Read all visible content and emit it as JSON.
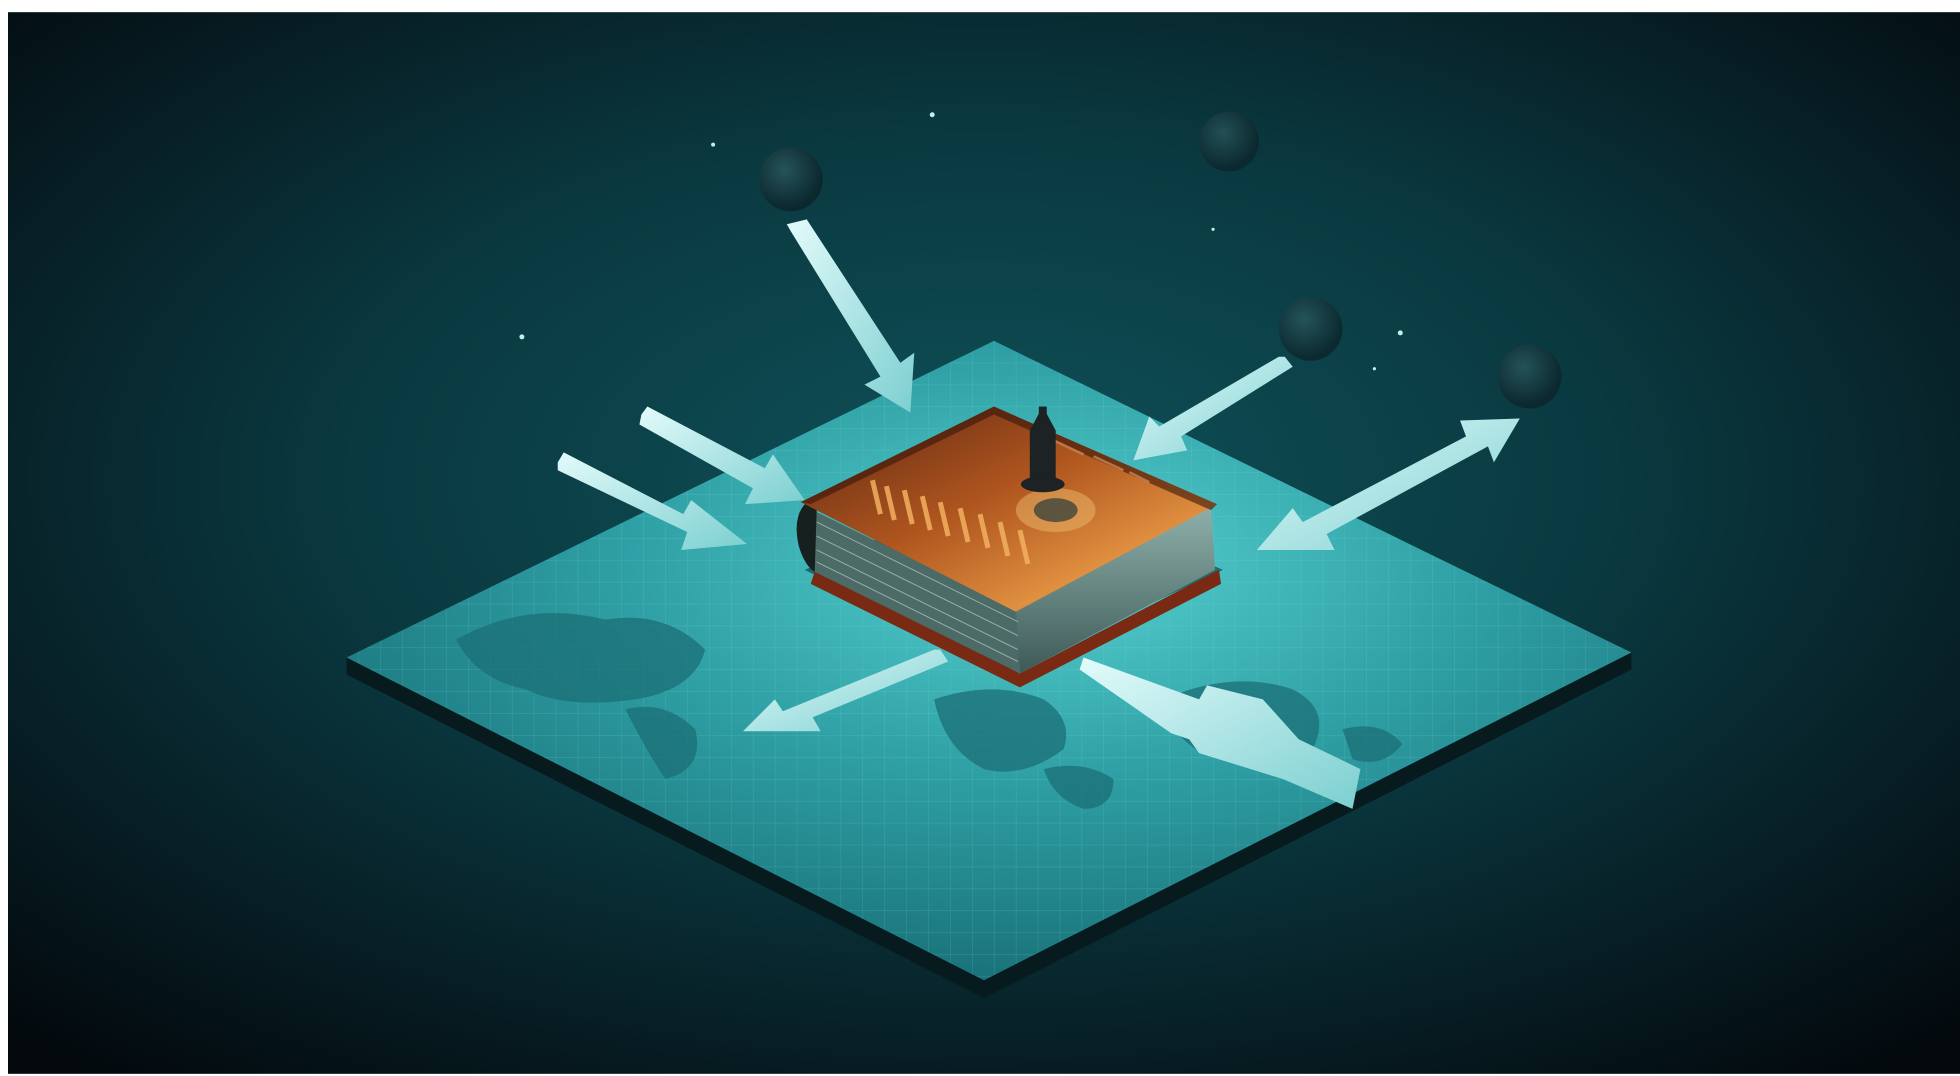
{
  "scene": {
    "description_kind": "isometric illustration",
    "book_title": "",
    "colors": {
      "background_center": "#0f4a52",
      "background_edge": "#050d12",
      "map_light": "#3fb4b8",
      "map_dark": "#13676d",
      "arrow_light": "#cdf6f5",
      "arrow_dark": "#6fc4c4",
      "book_cover": "#8a3a1c",
      "book_cover_glow": "#e0843a",
      "book_pages": "#55706c",
      "book_spine": "#1a2225"
    }
  }
}
